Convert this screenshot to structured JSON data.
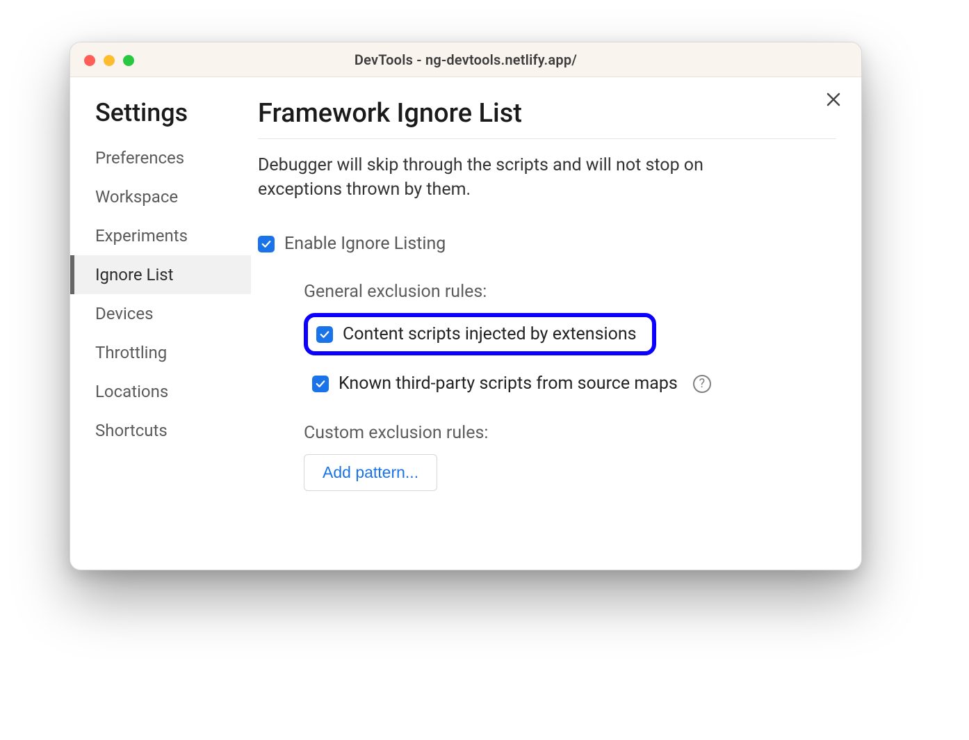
{
  "window": {
    "title": "DevTools - ng-devtools.netlify.app/"
  },
  "sidebar": {
    "title": "Settings",
    "items": [
      {
        "label": "Preferences"
      },
      {
        "label": "Workspace"
      },
      {
        "label": "Experiments"
      },
      {
        "label": "Ignore List",
        "active": true
      },
      {
        "label": "Devices"
      },
      {
        "label": "Throttling"
      },
      {
        "label": "Locations"
      },
      {
        "label": "Shortcuts"
      }
    ]
  },
  "page": {
    "title": "Framework Ignore List",
    "description": "Debugger will skip through the scripts and will not stop on exceptions thrown by them.",
    "enable_label": "Enable Ignore Listing",
    "general_section": "General exclusion rules:",
    "rule_content_scripts": "Content scripts injected by extensions",
    "rule_third_party": "Known third-party scripts from source maps",
    "custom_section": "Custom exclusion rules:",
    "add_pattern": "Add pattern..."
  }
}
